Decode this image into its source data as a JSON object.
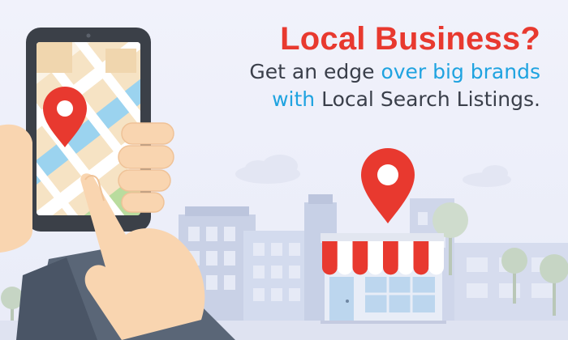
{
  "headline": {
    "title": "Local Business?",
    "line1_prefix": "Get an edge ",
    "line1_accent": "over big brands",
    "line2_accent": "with",
    "line2_rest": " Local Search Listings."
  },
  "icons": {
    "phone_pin": "map-pin-icon",
    "store_pin": "map-pin-icon",
    "store": "storefront-icon"
  },
  "colors": {
    "title": "#e8392f",
    "accent": "#1fa3e0",
    "body_text": "#3a3f4a",
    "pin": "#e8392f",
    "awning_red": "#e8392f",
    "background": "#eef0fa"
  }
}
